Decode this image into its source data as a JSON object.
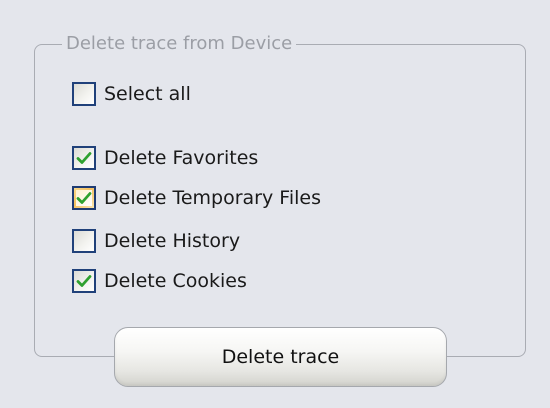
{
  "group": {
    "title": "Delete trace from Device"
  },
  "checkboxes": [
    {
      "label": "Select all",
      "checked": false,
      "highlighted": false
    },
    {
      "label": "Delete Favorites",
      "checked": true,
      "highlighted": false
    },
    {
      "label": "Delete Temporary Files",
      "checked": true,
      "highlighted": true
    },
    {
      "label": "Delete History",
      "checked": false,
      "highlighted": false
    },
    {
      "label": "Delete Cookies",
      "checked": true,
      "highlighted": false
    }
  ],
  "button": {
    "label": "Delete trace"
  },
  "colors": {
    "background": "#e4e6ec",
    "check_green": "#2fa12f",
    "checkbox_border": "#20417a",
    "hover_orange": "#f5c060"
  }
}
